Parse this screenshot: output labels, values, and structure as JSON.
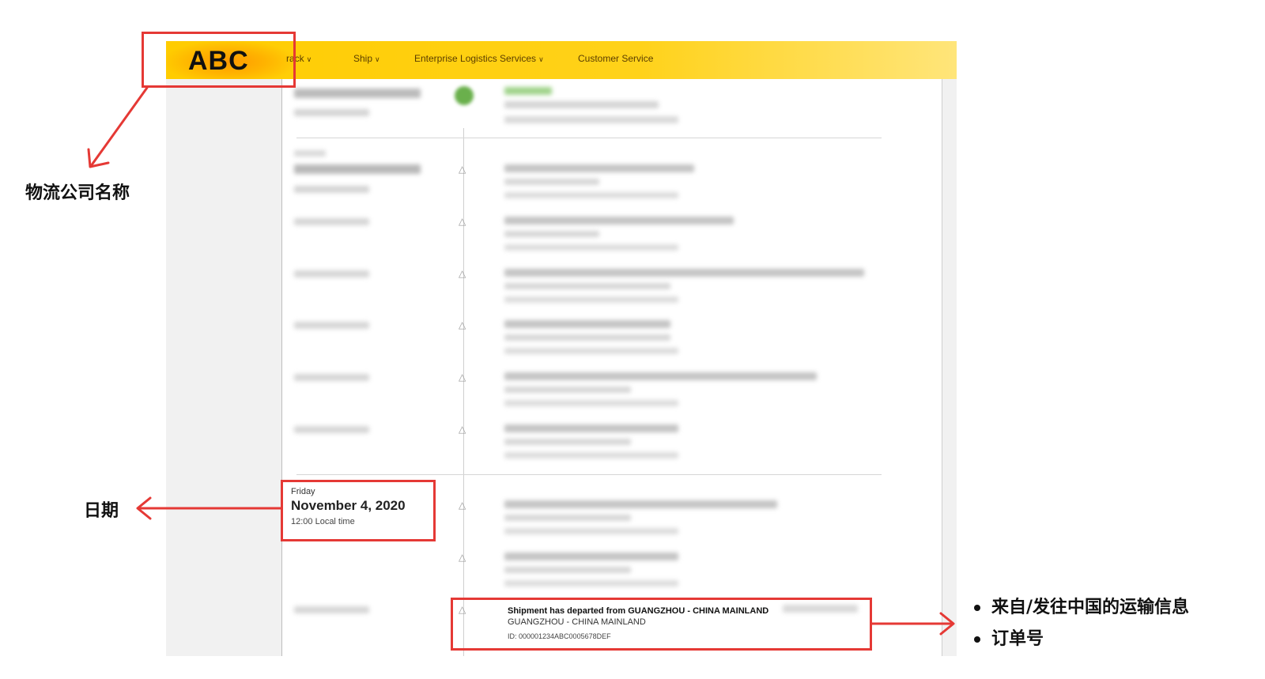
{
  "header": {
    "logo": "ABC",
    "nav": [
      {
        "label": "Track",
        "shown_as": "rack"
      },
      {
        "label": "Ship"
      },
      {
        "label": "Enterprise Logistics Services"
      },
      {
        "label": "Customer Service"
      }
    ]
  },
  "highlighted_date": {
    "weekday": "Friday",
    "date": "November 4, 2020",
    "time": "12:00 Local time"
  },
  "highlighted_event": {
    "title": "Shipment has departed from GUANGZHOU - CHINA MAINLAND",
    "location": "GUANGZHOU - CHINA MAINLAND",
    "id": "ID: 000001234ABC0005678DEF"
  },
  "annotations": {
    "company_name": "物流公司名称",
    "date": "日期",
    "bullets": [
      "来自/发往中国的运输信息",
      "订单号"
    ]
  },
  "colors": {
    "brand_yellow": "#ffcc00",
    "annotation_red": "#e53935"
  }
}
